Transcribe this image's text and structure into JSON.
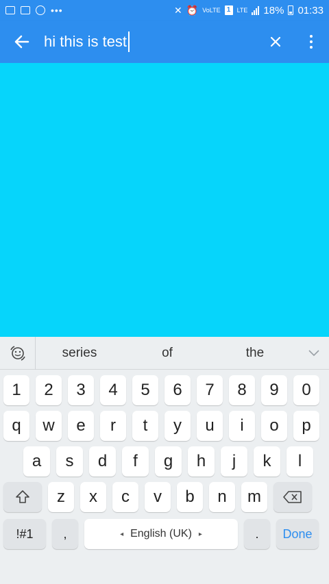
{
  "status_bar": {
    "battery": "18%",
    "time": "01:33",
    "volte": "VoLTE",
    "lte": "LTE",
    "sim": "1"
  },
  "search": {
    "query": "hi this is test"
  },
  "suggestions": [
    "series",
    "of",
    "the"
  ],
  "keyboard": {
    "numbers": [
      "1",
      "2",
      "3",
      "4",
      "5",
      "6",
      "7",
      "8",
      "9",
      "0"
    ],
    "row1": [
      "q",
      "w",
      "e",
      "r",
      "t",
      "y",
      "u",
      "i",
      "o",
      "p"
    ],
    "row2": [
      "a",
      "s",
      "d",
      "f",
      "g",
      "h",
      "j",
      "k",
      "l"
    ],
    "row3": [
      "z",
      "x",
      "c",
      "v",
      "b",
      "n",
      "m"
    ],
    "symbols_label": "!#1",
    "comma": ",",
    "space_label": "English (UK)",
    "period": ".",
    "done_label": "Done"
  }
}
